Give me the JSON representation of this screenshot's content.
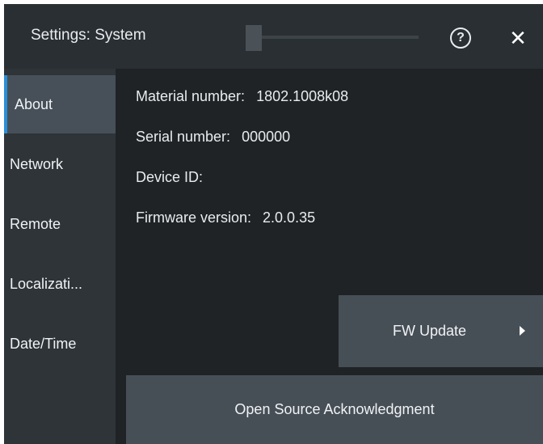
{
  "window": {
    "title": "Settings: System",
    "help_glyph": "?",
    "close_glyph": "✕"
  },
  "sidebar": {
    "items": [
      {
        "label": "About",
        "active": true
      },
      {
        "label": "Network",
        "active": false
      },
      {
        "label": "Remote",
        "active": false
      },
      {
        "label": "Localizati...",
        "active": false
      },
      {
        "label": "Date/Time",
        "active": false
      }
    ]
  },
  "about": {
    "material_number_label": "Material number:",
    "material_number_value": "1802.1008k08",
    "serial_number_label": "Serial number:",
    "serial_number_value": "000000",
    "device_id_label": "Device ID:",
    "device_id_value": "",
    "firmware_version_label": "Firmware version:",
    "firmware_version_value": "2.0.0.35"
  },
  "buttons": {
    "fw_update_label": "FW Update",
    "open_source_label": "Open Source Acknowledgment"
  },
  "colors": {
    "accent": "#2a8fd8",
    "background": "#1f2326",
    "sidebar": "#2e3438",
    "button": "#474f56"
  }
}
